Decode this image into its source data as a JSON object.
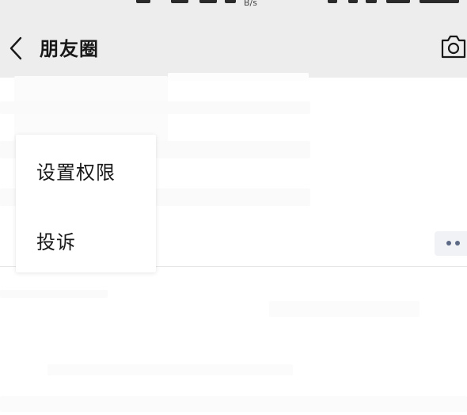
{
  "status_bar": {
    "speed_unit": "B/s"
  },
  "nav": {
    "title": "朋友圈",
    "back_icon": "chevron-left-icon",
    "camera_icon": "camera-icon"
  },
  "menu": {
    "items": [
      {
        "label": "设置权限"
      },
      {
        "label": "投诉"
      }
    ]
  },
  "feed": {
    "more_icon": "more-dots-icon"
  },
  "colors": {
    "nav_background": "#ededed",
    "text": "#191919",
    "link_dots": "#5d6a86",
    "more_button_background": "#f1f2f5"
  }
}
